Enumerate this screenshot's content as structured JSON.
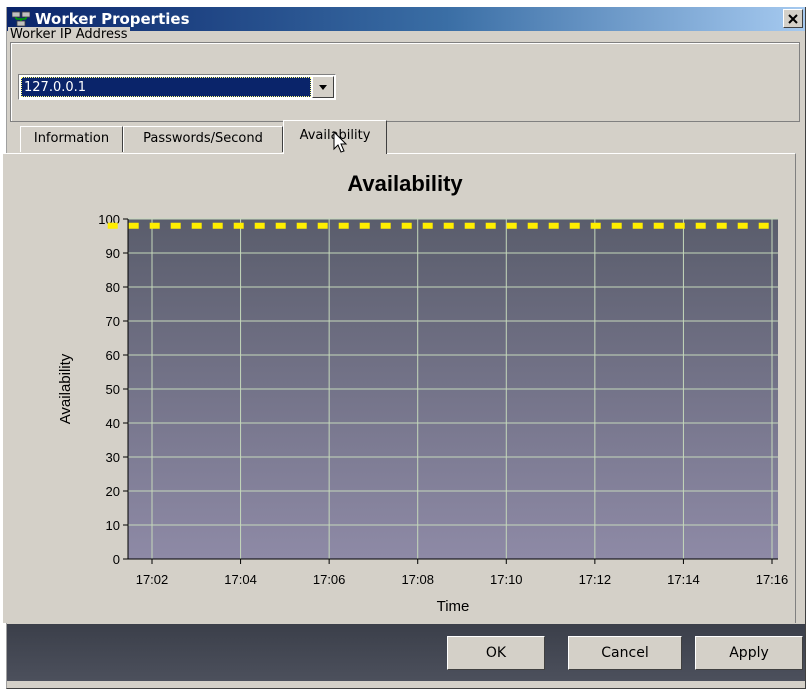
{
  "window": {
    "title": "Worker Properties",
    "colors": {
      "titlebar_start": "#0a246a",
      "titlebar_end": "#a6caf0",
      "face": "#d4d0c8"
    }
  },
  "ip_group": {
    "label": "Worker IP Address",
    "selected": "127.0.0.1"
  },
  "tabs": [
    {
      "label": "Information",
      "active": false
    },
    {
      "label": "Passwords/Second",
      "active": false
    },
    {
      "label": "Availability",
      "active": true
    }
  ],
  "chart_data": {
    "type": "line",
    "title": "Availability",
    "xlabel": "Time",
    "ylabel": "Availability",
    "ylim": [
      0,
      100
    ],
    "yticks": [
      0,
      10,
      20,
      30,
      40,
      50,
      60,
      70,
      80,
      90,
      100
    ],
    "x_tick_labels": [
      "17:02",
      "17:04",
      "17:06",
      "17:08",
      "17:10",
      "17:12",
      "17:14",
      "17:16"
    ],
    "series": [
      {
        "color": "#ffee00",
        "style": "dashed",
        "x": [
          "17:01",
          "17:16"
        ],
        "values": [
          98,
          98
        ]
      }
    ],
    "grid": true,
    "colors": {
      "plot_top": "#5a5d6c",
      "plot_bottom": "#8e8aa6",
      "grid": "#c5d8bb",
      "series": "#ffee00"
    }
  },
  "buttons": {
    "ok": "OK",
    "cancel": "Cancel",
    "apply": "Apply"
  }
}
